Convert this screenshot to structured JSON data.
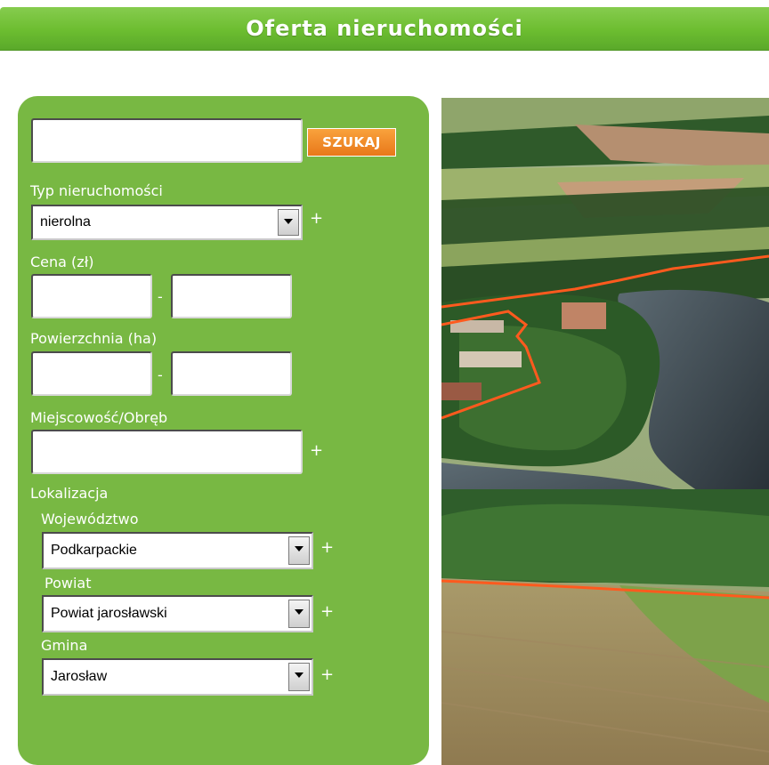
{
  "header": {
    "title": "Oferta nieruchomości"
  },
  "search": {
    "value": "",
    "button_label": "SZUKAJ"
  },
  "property_type": {
    "label": "Typ nieruchomości",
    "selected": "nierolna"
  },
  "price": {
    "label": "Cena (zł)",
    "min": "",
    "max": "",
    "separator": "-"
  },
  "area": {
    "label": "Powierzchnia (ha)",
    "min": "",
    "max": "",
    "separator": "-"
  },
  "locality": {
    "label": "Miejscowość/Obręb",
    "value": ""
  },
  "location": {
    "label": "Lokalizacja",
    "voivodeship": {
      "label": "Województwo",
      "selected": "Podkarpackie"
    },
    "district": {
      "label": "Powiat",
      "selected": "Powiat jarosławski"
    },
    "commune": {
      "label": "Gmina",
      "selected": "Jarosław"
    }
  },
  "add_symbol": "+",
  "colors": {
    "panel_green": "#78b843",
    "header_green": "#6cbd30",
    "button_orange": "#f08c28",
    "parcel_outline": "#ff5a1e"
  },
  "icons": [
    "chevron-down-icon",
    "plus-icon"
  ]
}
